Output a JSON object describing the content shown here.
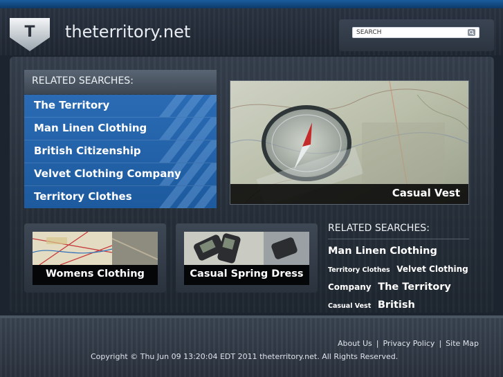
{
  "header": {
    "logo_letter": "T",
    "site_title": "theterritory.net",
    "search_placeholder": "SEARCH"
  },
  "related_searches": {
    "title": "RELATED SEARCHES:",
    "items": [
      {
        "label": "The Territory"
      },
      {
        "label": "Man Linen Clothing"
      },
      {
        "label": "British Citizenship"
      },
      {
        "label": "Velvet Clothing Company"
      },
      {
        "label": "Territory Clothes"
      }
    ]
  },
  "hero": {
    "caption": "Casual Vest"
  },
  "thumbs": [
    {
      "caption": "Womens Clothing"
    },
    {
      "caption": "Casual Spring Dress"
    }
  ],
  "related_searches_2": {
    "title": "RELATED SEARCHES:",
    "cloud": [
      {
        "label": "Man Linen Clothing",
        "size": "lg"
      },
      {
        "label": "Territory Clothes",
        "size": "sm"
      },
      {
        "label": "Velvet Clothing Company",
        "size": "md"
      },
      {
        "label": "The Territory",
        "size": "lg"
      },
      {
        "label": "Casual Vest",
        "size": "sm"
      },
      {
        "label": "British Citizenship",
        "size": "lg"
      }
    ]
  },
  "footer": {
    "links": [
      "About Us",
      "Privacy Policy",
      "Site Map"
    ],
    "copyright": "Copyright © Thu Jun 09 13:20:04 EDT 2011 theterritory.net. All Rights Reserved."
  },
  "colors": {
    "accent_blue": "#2a6bb4",
    "header_bar": "#1a5c9e",
    "background": "#1c2430"
  }
}
